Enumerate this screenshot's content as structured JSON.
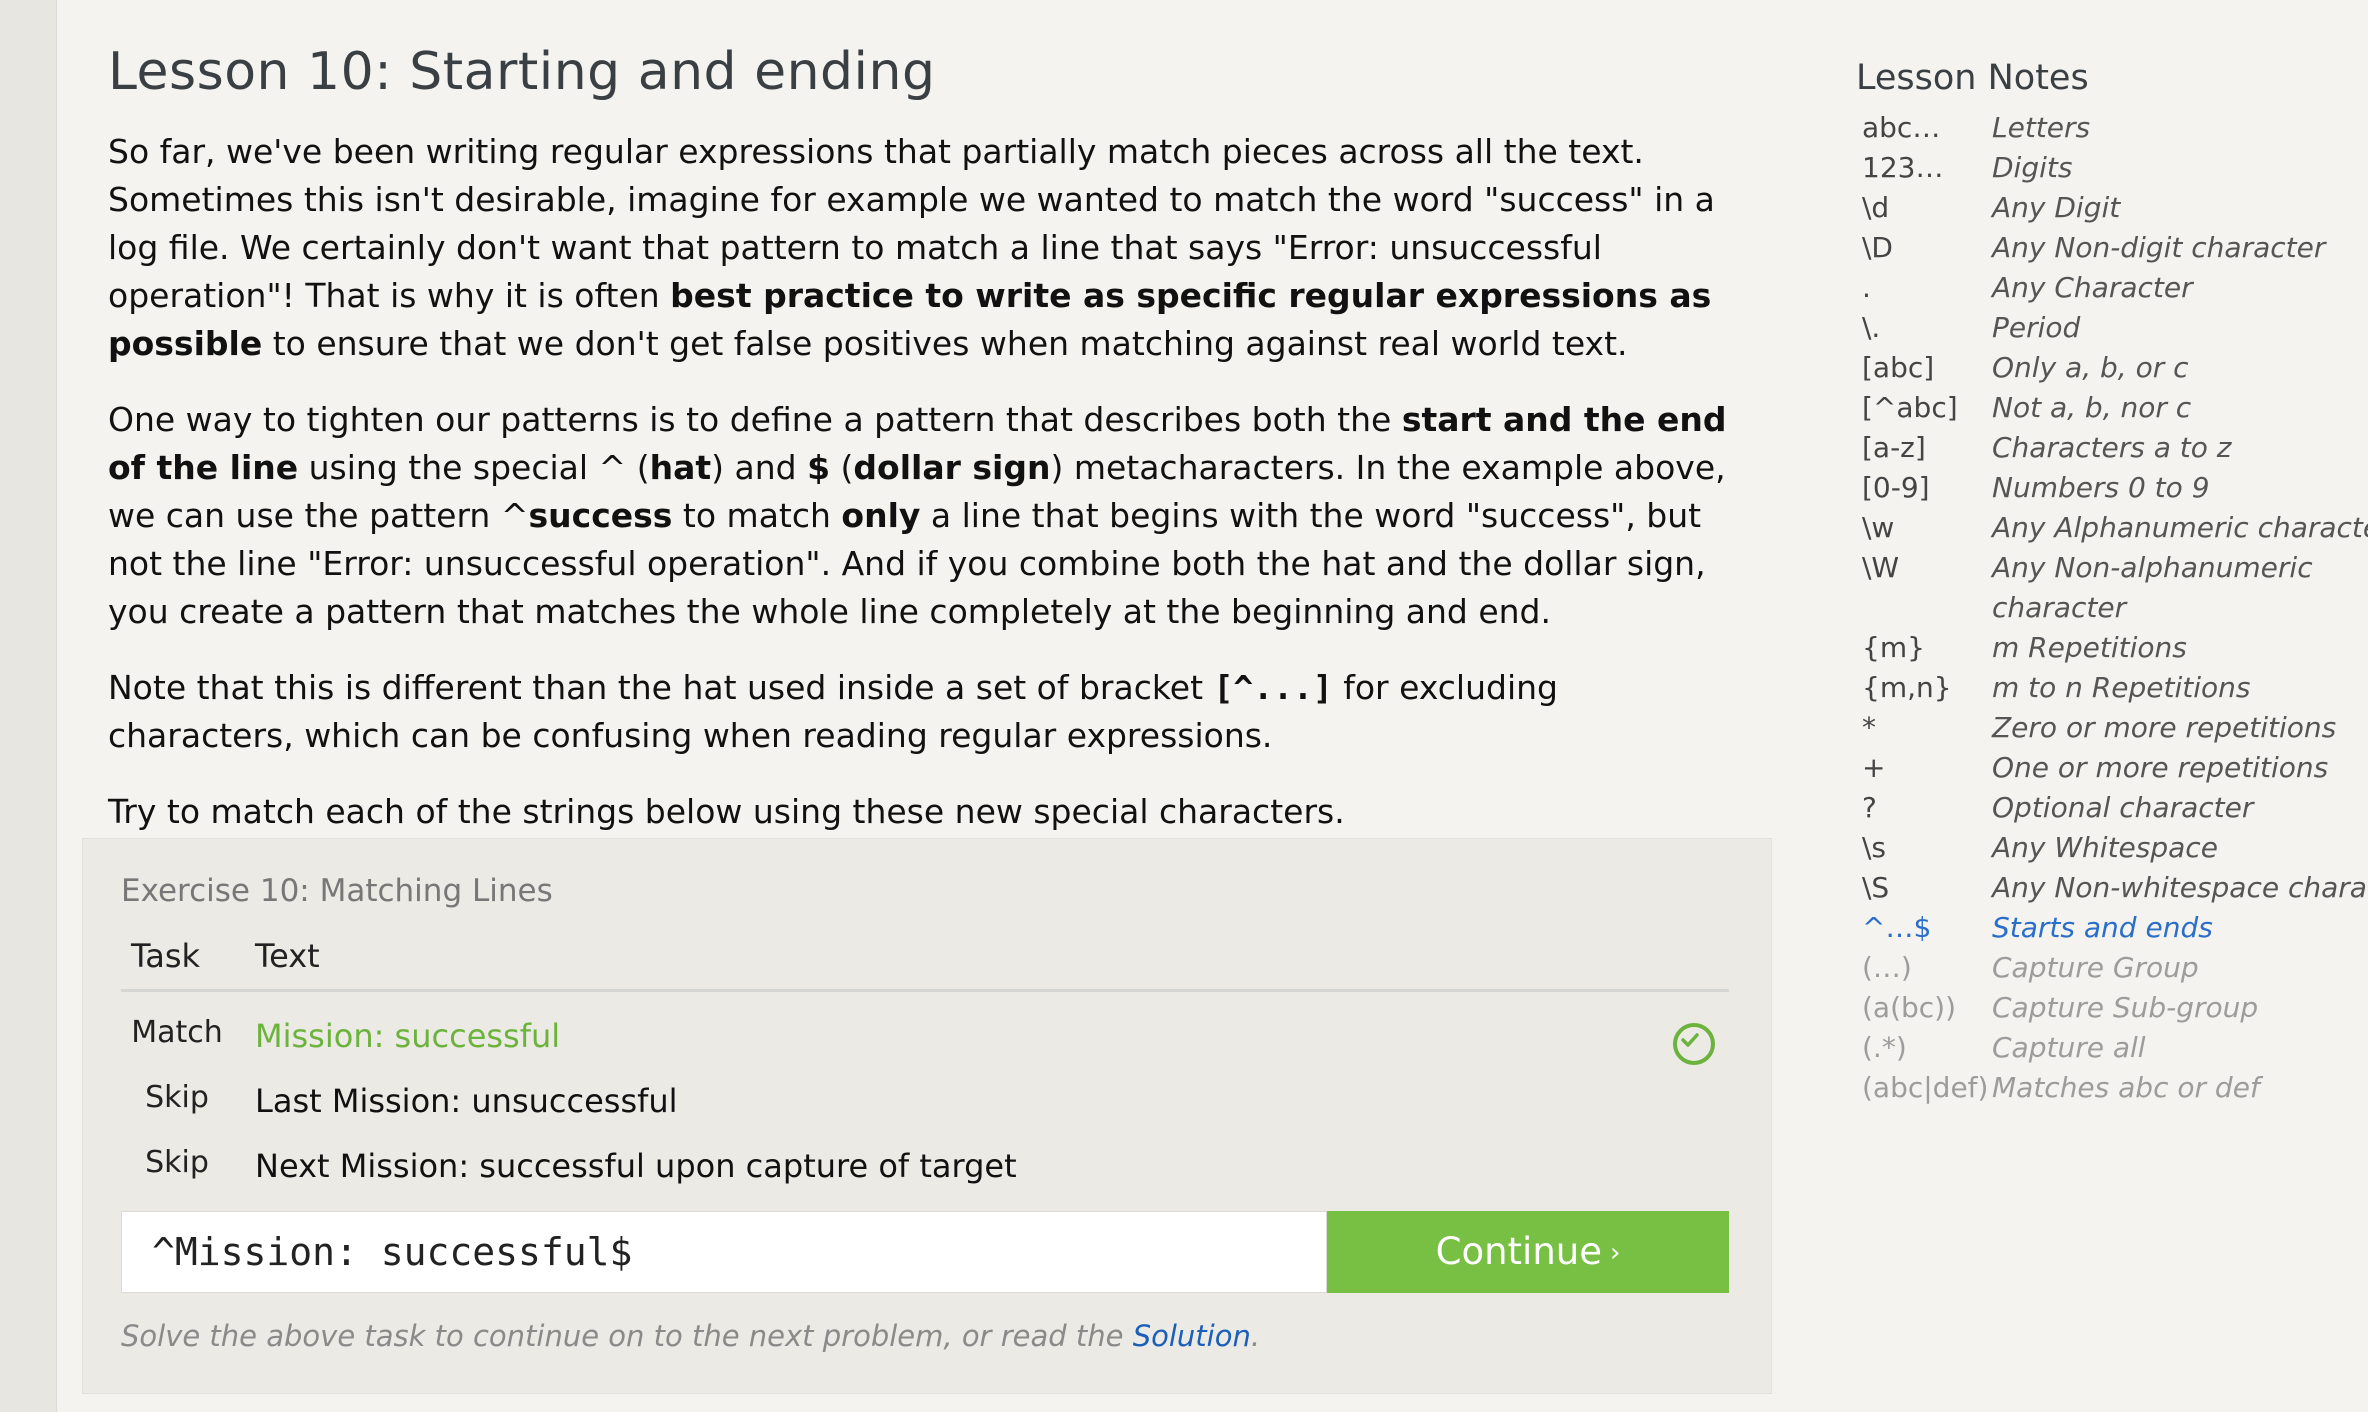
{
  "lesson": {
    "title": "Lesson 10: Starting and ending",
    "p1": {
      "a": "So far, we've been writing regular expressions that partially match pieces across all the text. Sometimes this isn't desirable, imagine for example we wanted to match the word \"success\" in a log file. We certainly don't want that pattern to match a line that says \"Error: unsuccessful operation\"! That is why it is often ",
      "b": "best practice to write as specific regular expressions as possible",
      "c": " to ensure that we don't get false positives when matching against real world text."
    },
    "p2": {
      "a": "One way to tighten our patterns is to define a pattern that describes both the ",
      "b": "start and the end of the line",
      "c": " using the special ^ (",
      "d": "hat",
      "e": ") and ",
      "f": "$",
      "g": " (",
      "h": "dollar sign",
      "i": ") metacharacters. In the example above, we can use the pattern ^",
      "j": "success",
      "k": " to match ",
      "l": "only",
      "m": " a line that begins with the word \"success\", but not the line \"Error: unsuccessful operation\". And if you combine both the hat and the dollar sign, you create a pattern that matches the whole line completely at the beginning and end."
    },
    "p3": {
      "a": "Note that this is different than the hat used inside a set of bracket ",
      "b": "[^...]",
      "c": " for excluding characters, which can be confusing when reading regular expressions."
    },
    "p4": "Try to match each of the strings below using these new special characters."
  },
  "exercise": {
    "title": "Exercise 10: Matching Lines",
    "header_task": "Task",
    "header_text": "Text",
    "rows": [
      {
        "task": "Match",
        "text": "Mission: successful",
        "status": "matched"
      },
      {
        "task": "Skip",
        "text": "Last Mission: unsuccessful",
        "status": "pending"
      },
      {
        "task": "Skip",
        "text": "Next Mission: successful upon capture of target",
        "status": "pending"
      }
    ],
    "input_value": "^Mission: successful$",
    "continue_label": "Continue",
    "continue_chevron": "›",
    "hint_before": "Solve the above task to continue on to the next problem, or read the ",
    "hint_link": "Solution",
    "hint_after": ".",
    "accent_color": "#77c043"
  },
  "notes": {
    "title": "Lesson Notes",
    "items": [
      {
        "sym": "abc…",
        "desc": "Letters",
        "state": "done"
      },
      {
        "sym": "123…",
        "desc": "Digits",
        "state": "done"
      },
      {
        "sym": "\\d",
        "desc": "Any Digit",
        "state": "done"
      },
      {
        "sym": "\\D",
        "desc": "Any Non-digit character",
        "state": "done"
      },
      {
        "sym": ".",
        "desc": "Any Character",
        "state": "done"
      },
      {
        "sym": "\\.",
        "desc": "Period",
        "state": "done"
      },
      {
        "sym": "[abc]",
        "desc": "Only a, b, or c",
        "state": "done"
      },
      {
        "sym": "[^abc]",
        "desc": "Not a, b, nor c",
        "state": "done"
      },
      {
        "sym": "[a-z]",
        "desc": "Characters a to z",
        "state": "done"
      },
      {
        "sym": "[0-9]",
        "desc": "Numbers 0 to 9",
        "state": "done"
      },
      {
        "sym": "\\w",
        "desc": "Any Alphanumeric character",
        "state": "done"
      },
      {
        "sym": "\\W",
        "desc": "Any Non-alphanumeric character",
        "state": "done"
      },
      {
        "sym": "{m}",
        "desc": "m Repetitions",
        "state": "done"
      },
      {
        "sym": "{m,n}",
        "desc": "m to n Repetitions",
        "state": "done"
      },
      {
        "sym": "*",
        "desc": "Zero or more repetitions",
        "state": "done"
      },
      {
        "sym": "+",
        "desc": "One or more repetitions",
        "state": "done"
      },
      {
        "sym": "?",
        "desc": "Optional character",
        "state": "done"
      },
      {
        "sym": "\\s",
        "desc": "Any Whitespace",
        "state": "done"
      },
      {
        "sym": "\\S",
        "desc": "Any Non-whitespace characte",
        "state": "done"
      },
      {
        "sym": "^…$",
        "desc": "Starts and ends",
        "state": "current"
      },
      {
        "sym": "(…)",
        "desc": "Capture Group",
        "state": "future"
      },
      {
        "sym": "(a(bc))",
        "desc": "Capture Sub-group",
        "state": "future"
      },
      {
        "sym": "(.*)",
        "desc": "Capture all",
        "state": "future"
      },
      {
        "sym": "(abc|def)",
        "desc": "Matches abc or def",
        "state": "future"
      }
    ],
    "current_color": "#2a6ec9",
    "future_color": "#9c9c9c"
  }
}
